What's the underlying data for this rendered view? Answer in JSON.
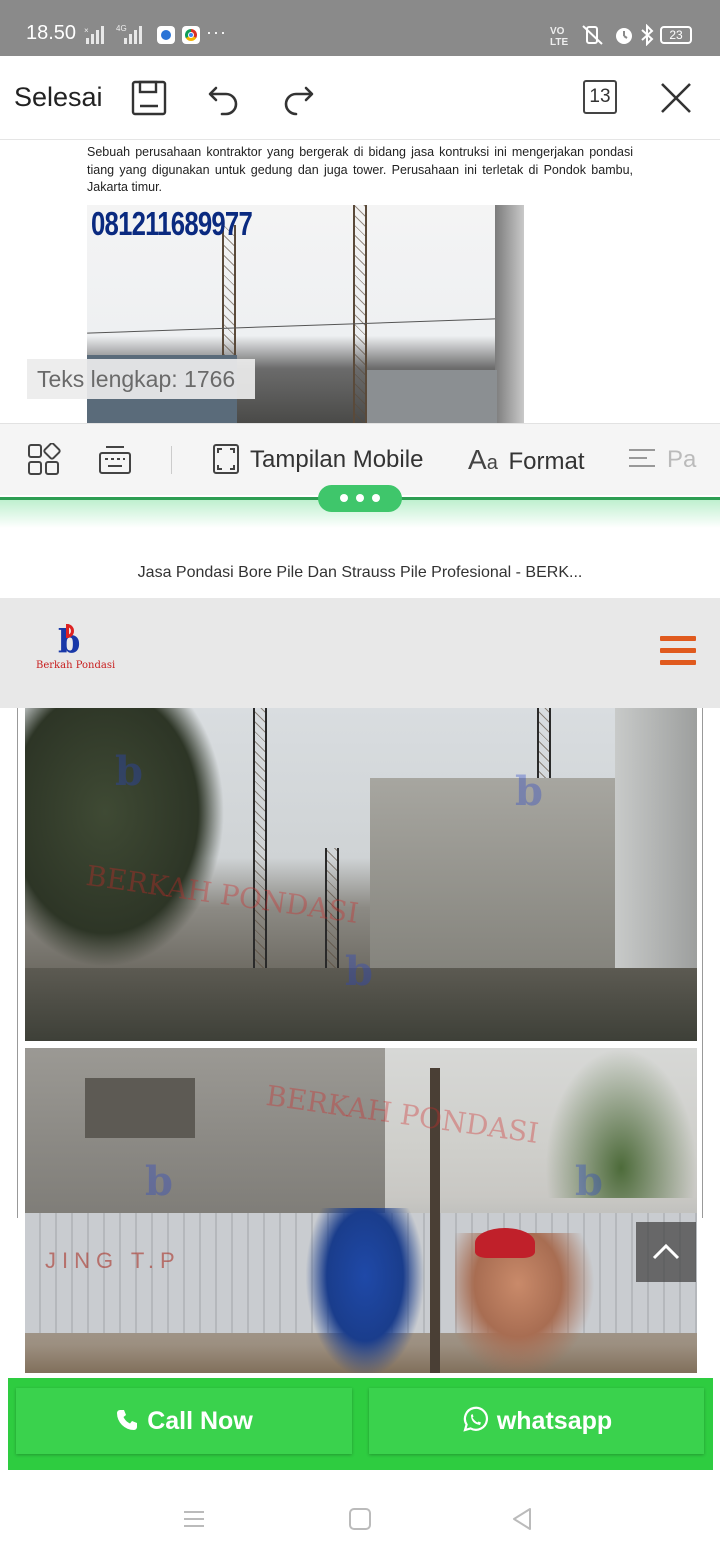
{
  "status_bar": {
    "time": "18.50",
    "battery": "23",
    "more": "···"
  },
  "editor_toolbar": {
    "done_label": "Selesai",
    "page_count": "13"
  },
  "document": {
    "paragraph": "Sebuah perusahaan kontraktor yang bergerak di bidang jasa kontruksi ini mengerjakan pondasi tiang yang digunakan untuk gedung dan juga tower. Perusahaan ini terletak di Pondok bambu, Jakarta timur.",
    "phone_overlay": "081211689977",
    "char_count": "Teks lengkap: 1766"
  },
  "format_toolbar": {
    "mobile_view_label": "Tampilan Mobile",
    "format_label": "Format",
    "paragraph_label": "Pa"
  },
  "web_page": {
    "title": "Jasa Pondasi Bore Pile Dan Strauss Pile Profesional - BERK...",
    "logo_text": "Berkah Pondasi",
    "watermark_text": "BERKAH PONDASI",
    "sign_text": "JING T.P"
  },
  "cta": {
    "call_label": "Call Now",
    "whatsapp_label": "whatsapp"
  },
  "colors": {
    "accent_green": "#2ecc40",
    "menu_orange": "#e05a1e",
    "split_green": "#3fc66b"
  }
}
